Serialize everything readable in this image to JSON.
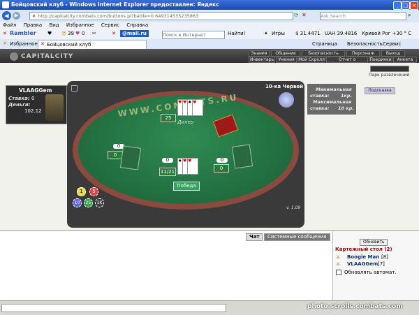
{
  "browser": {
    "title": "Бойцовский клуб - Windows Internet Explorer предоставлен: Яндекс",
    "url": "http://capitalcity.combats.com/buttons.pl?battle=0.649314535235863",
    "search_placeholder": "Ask Search",
    "menu": [
      "Файл",
      "Правка",
      "Вид",
      "Избранное",
      "Сервис",
      "Справка"
    ],
    "toolbar": {
      "rambler": "Rambler",
      "count1": "39",
      "count2": "0",
      "mailru": "@mail.ru",
      "search_placeholder": "Поиск в Интернет",
      "find": "Найти!",
      "games": "Игры",
      "usd": "$ 31.4471",
      "uah": "UAH 39.4816",
      "weather": "Кривой Рог +30 ° C"
    },
    "favorites": "Избранное",
    "tab": "Бойцовский клуб",
    "page_menu": [
      "Страница",
      "Безопасность",
      "Сервис"
    ]
  },
  "game": {
    "logo": "CAPITALCITY",
    "nav_top": [
      "Знания",
      "Общение",
      "Безопасность",
      "Персонаж",
      "Выход"
    ],
    "nav_bottom": [
      "Инвентарь",
      "Умения",
      "Мой Скролл",
      "Отчет о переводах",
      "Поединки",
      "Анкета"
    ],
    "park": "Парк развлечений",
    "hint": "Подсказка",
    "player": {
      "name": "VLAAGGem",
      "stake_label": "Ставка:",
      "stake": "0",
      "money_label": "Деньги:",
      "money": "102.12"
    },
    "table": {
      "site": "WWW.COMBATS.RU",
      "title": "10-ка Червей",
      "dealer": "Дилер",
      "dealer_score": "25",
      "left_bet": "0",
      "left_score": "0",
      "center_bet": "0",
      "center_score": "11/21",
      "right_bet": "0",
      "right_score": "0",
      "win": "Победа",
      "version": "v. 1.09",
      "chips": [
        "1",
        "5",
        "10",
        "25",
        "1K"
      ]
    },
    "stakes": {
      "min_label": "Минимальная",
      "min_label2": "ставка:",
      "min_value": "1кр.",
      "max_label": "Максимальная",
      "max_label2": "ставка:",
      "max_value": "10 кр."
    }
  },
  "chat": {
    "tab_chat": "Чат",
    "tab_system": "Системные сообщения",
    "refresh": "Обновить",
    "room": "Картежный стол (2)",
    "users": [
      {
        "name": "Boogie Man",
        "level": "[8]"
      },
      {
        "name": "VLAAGGem",
        "level": "[7]"
      }
    ],
    "auto_refresh": "Обновлять автомат."
  },
  "watermark": "photo.scrolls.combats.com"
}
